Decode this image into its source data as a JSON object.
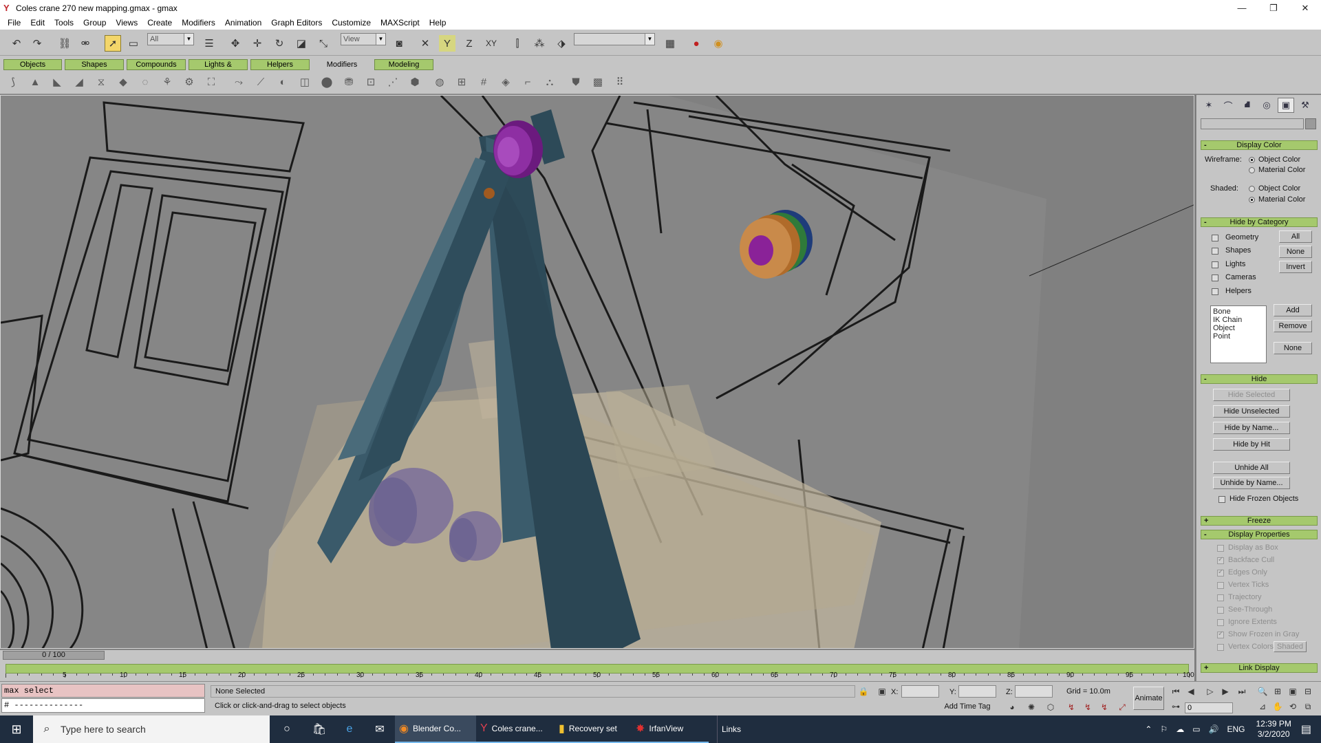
{
  "window": {
    "title": "Coles crane 270 new mapping.gmax - gmax",
    "minimize": "—",
    "maximize": "❐",
    "close": "✕"
  },
  "menu": [
    "File",
    "Edit",
    "Tools",
    "Group",
    "Views",
    "Create",
    "Modifiers",
    "Animation",
    "Graph Editors",
    "Customize",
    "MAXScript",
    "Help"
  ],
  "toolbar": {
    "selection_filter": "All",
    "ref_coord": "View",
    "named_selection": ""
  },
  "tabs": [
    "Objects",
    "Shapes",
    "Compounds",
    "Lights & Cameras",
    "Helpers",
    "Modifiers",
    "Modeling"
  ],
  "active_tab": "Modifiers",
  "command_panel": {
    "display_color": {
      "header": "Display Color",
      "wireframe_label": "Wireframe:",
      "shaded_label": "Shaded:",
      "object_color": "Object Color",
      "material_color": "Material Color",
      "wireframe_selected": "Object Color",
      "shaded_selected": "Material Color"
    },
    "hide_by_category": {
      "header": "Hide by Category",
      "items": [
        {
          "label": "Geometry",
          "checked": false
        },
        {
          "label": "Shapes",
          "checked": false
        },
        {
          "label": "Lights",
          "checked": false
        },
        {
          "label": "Cameras",
          "checked": false
        },
        {
          "label": "Helpers",
          "checked": false
        }
      ],
      "all": "All",
      "none": "None",
      "invert": "Invert",
      "list": [
        "Bone",
        "IK Chain Object",
        "Point"
      ],
      "add": "Add",
      "remove": "Remove",
      "none2": "None"
    },
    "hide": {
      "header": "Hide",
      "hide_selected": "Hide Selected",
      "hide_unselected": "Hide Unselected",
      "hide_by_name": "Hide by Name...",
      "hide_by_hit": "Hide by Hit",
      "unhide_all": "Unhide All",
      "unhide_by_name": "Unhide by Name...",
      "hide_frozen": "Hide Frozen Objects"
    },
    "freeze": {
      "header": "Freeze"
    },
    "display_properties": {
      "header": "Display Properties",
      "items": [
        {
          "label": "Display as Box",
          "checked": false
        },
        {
          "label": "Backface Cull",
          "checked": true
        },
        {
          "label": "Edges Only",
          "checked": true
        },
        {
          "label": "Vertex Ticks",
          "checked": false
        },
        {
          "label": "Trajectory",
          "checked": false
        },
        {
          "label": "See-Through",
          "checked": false
        },
        {
          "label": "Ignore Extents",
          "checked": false
        },
        {
          "label": "Show Frozen in Gray",
          "checked": true
        },
        {
          "label": "Vertex Colors",
          "checked": false
        }
      ],
      "shaded": "Shaded"
    },
    "link_display": {
      "header": "Link Display"
    }
  },
  "timeline": {
    "frame_display": "0 / 100",
    "current_frame": 0,
    "total_frames": 100,
    "ticks": [
      "5",
      "10",
      "15",
      "20",
      "25",
      "30",
      "35",
      "40",
      "45",
      "50",
      "55",
      "60",
      "65",
      "70",
      "75",
      "80",
      "85",
      "90",
      "95",
      "100"
    ]
  },
  "status": {
    "listener_input": "max select",
    "listener_output": "# --------------",
    "selection": "None Selected",
    "prompt": "Click or click-and-drag to select objects",
    "x_label": "X:",
    "y_label": "Y:",
    "z_label": "Z:",
    "grid": "Grid = 10.0m",
    "add_time_tag": "Add Time Tag",
    "animate": "Animate",
    "frame": "0"
  },
  "taskbar": {
    "search_placeholder": "Type here to search",
    "apps": [
      {
        "label": "Blender Co...",
        "icon": "blender-icon"
      },
      {
        "label": "Coles crane...",
        "icon": "gmax-icon"
      },
      {
        "label": "Recovery set",
        "icon": "folder-icon"
      },
      {
        "label": "IrfanView",
        "icon": "irfanview-icon"
      }
    ],
    "links": "Links",
    "lang": "ENG",
    "time": "12:39 PM",
    "date": "3/2/2020"
  }
}
